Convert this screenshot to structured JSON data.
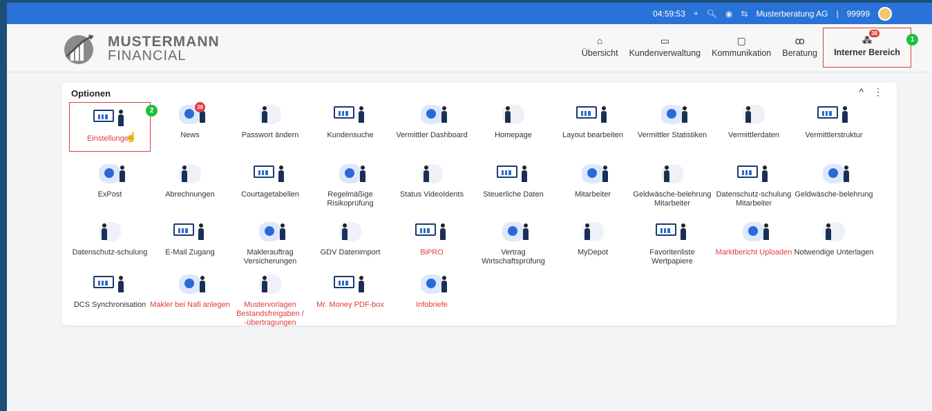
{
  "topbar": {
    "time": "04:59:53",
    "company": "Musterberatung AG",
    "separator": "|",
    "user_id": "99999"
  },
  "logo": {
    "line1": "MUSTERMANN",
    "line2": "FINANCIAL"
  },
  "nav": {
    "items": [
      {
        "label": "Übersicht",
        "icon": "home-icon"
      },
      {
        "label": "Kundenverwaltung",
        "icon": "id-card-icon"
      },
      {
        "label": "Kommunikation",
        "icon": "chat-icon"
      },
      {
        "label": "Beratung",
        "icon": "users-icon"
      },
      {
        "label": "Interner Bereich",
        "icon": "network-icon",
        "badge": "38",
        "active": true
      }
    ]
  },
  "steps": {
    "one": "1",
    "two": "2"
  },
  "panel": {
    "title": "Optionen",
    "collapse": "^",
    "more": "⋮"
  },
  "tiles": [
    {
      "label": "Einstellungen",
      "red": true
    },
    {
      "label": "News",
      "badge": "38"
    },
    {
      "label": "Passwort ändern"
    },
    {
      "label": "Kundensuche"
    },
    {
      "label": "Vermittler Dashboard"
    },
    {
      "label": "Homepage"
    },
    {
      "label": "Layout bearbeiten"
    },
    {
      "label": "Vermittler Statistiken"
    },
    {
      "label": "Vermittlerdaten"
    },
    {
      "label": "Vermittlerstruktur"
    },
    {
      "label": "ExPost"
    },
    {
      "label": "Abrechnungen"
    },
    {
      "label": "Courtagetabellen"
    },
    {
      "label": "Regelmäßige Risikoprüfung"
    },
    {
      "label": "Status VideoIdents"
    },
    {
      "label": "Steuerliche Daten"
    },
    {
      "label": "Mitarbeiter"
    },
    {
      "label": "Geldwäsche-belehrung Mitarbeiter"
    },
    {
      "label": "Datenschutz-schulung Mitarbeiter"
    },
    {
      "label": "Geldwäsche-belehrung"
    },
    {
      "label": "Datenschutz-schulung"
    },
    {
      "label": "E-Mail Zugang"
    },
    {
      "label": "Maklerauftrag Versicherungen"
    },
    {
      "label": "GDV Datenimport"
    },
    {
      "label": "BiPRO",
      "red": true
    },
    {
      "label": "Vertrag Wirtschaftsprüfung"
    },
    {
      "label": "MyDepot"
    },
    {
      "label": "Favoritenliste Wertpapiere"
    },
    {
      "label": "Marktbericht Uploaden",
      "red": true
    },
    {
      "label": "Notwendige Unterlagen"
    },
    {
      "label": "DCS Synchronisation"
    },
    {
      "label": "Makler bei Nafi anlegen",
      "red": true
    },
    {
      "label": "Mustervorlagen Bestandsfreigaben / -übertragungen",
      "red": true
    },
    {
      "label": "Mr. Money PDF-box",
      "red": true
    },
    {
      "label": "Infobriefe",
      "red": true
    }
  ],
  "colors": {
    "topbar": "#2872d8",
    "accent_red": "#e03a3a",
    "step_green": "#18c23a",
    "navy": "#1a2f55"
  }
}
